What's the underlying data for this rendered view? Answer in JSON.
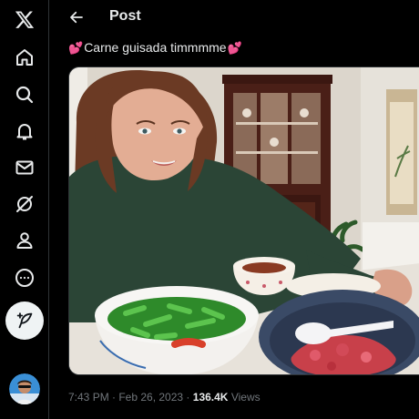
{
  "header": {
    "title": "Post"
  },
  "tweet": {
    "text": "Carne guisada timmmme",
    "timestamp": "7:43 PM · Feb 26, 2023",
    "separator": "·",
    "views_count": "136.4K",
    "views_label": "Views"
  },
  "sidebar": {
    "items": [
      {
        "icon": "x-logo-icon"
      },
      {
        "icon": "home-icon"
      },
      {
        "icon": "search-icon"
      },
      {
        "icon": "bell-icon"
      },
      {
        "icon": "mail-icon"
      },
      {
        "icon": "grok-icon"
      },
      {
        "icon": "profile-icon"
      },
      {
        "icon": "more-icon"
      }
    ],
    "compose_icon": "feather-plus-icon"
  },
  "colors": {
    "background": "#000000",
    "text": "#e7e9ea",
    "muted": "#71767b",
    "border": "#2f3336",
    "heart": "#f5427b"
  }
}
